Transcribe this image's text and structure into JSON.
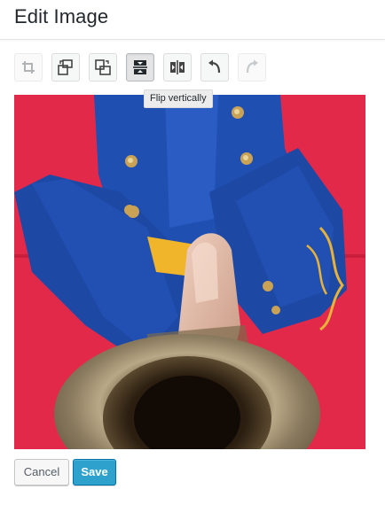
{
  "header": {
    "title": "Edit Image"
  },
  "toolbar": {
    "buttons": [
      {
        "name": "crop",
        "icon": "crop-icon",
        "state": "disabled"
      },
      {
        "name": "rotate-left",
        "icon": "rotate-left-icon",
        "state": "enabled"
      },
      {
        "name": "rotate-right",
        "icon": "rotate-right-icon",
        "state": "enabled"
      },
      {
        "name": "flip-vertical",
        "icon": "flip-vertical-icon",
        "state": "active"
      },
      {
        "name": "flip-horizontal",
        "icon": "flip-horizontal-icon",
        "state": "enabled"
      },
      {
        "name": "undo",
        "icon": "undo-icon",
        "state": "enabled"
      },
      {
        "name": "redo",
        "icon": "redo-icon",
        "state": "disabled"
      }
    ],
    "tooltip": "Flip vertically"
  },
  "image": {
    "subject": "photo-preview",
    "background_color": "#e3294a"
  },
  "footer": {
    "cancel_label": "Cancel",
    "save_label": "Save"
  },
  "colors": {
    "accent": "#2ea2cc",
    "text": "#23282d"
  }
}
